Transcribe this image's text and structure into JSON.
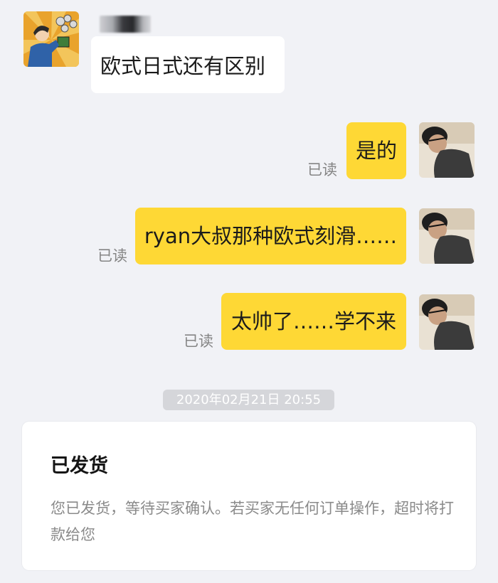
{
  "chat": {
    "incoming": {
      "sender_name": "",
      "text": "欧式日式还有区别"
    },
    "outgoing": [
      {
        "text": "是的",
        "status": "已读"
      },
      {
        "text": "ryan大叔那种欧式刻滑……",
        "status": "已读"
      },
      {
        "text": "太帅了……学不来",
        "status": "已读"
      }
    ],
    "timestamp": "2020年02月21日 20:55"
  },
  "order_card": {
    "title": "已发货",
    "description": "您已发货，等待买家确认。若买家无任何订单操作，超时将打款给您"
  },
  "colors": {
    "background": "#f1f2f6",
    "outgoing_bubble": "#fed835",
    "incoming_bubble": "#ffffff",
    "read_text": "#858585",
    "timestamp_pill": "#d5d6da"
  },
  "icons": {
    "left_avatar": "cartoon-avatar-icon",
    "right_avatar": "user-photo-avatar-icon"
  }
}
